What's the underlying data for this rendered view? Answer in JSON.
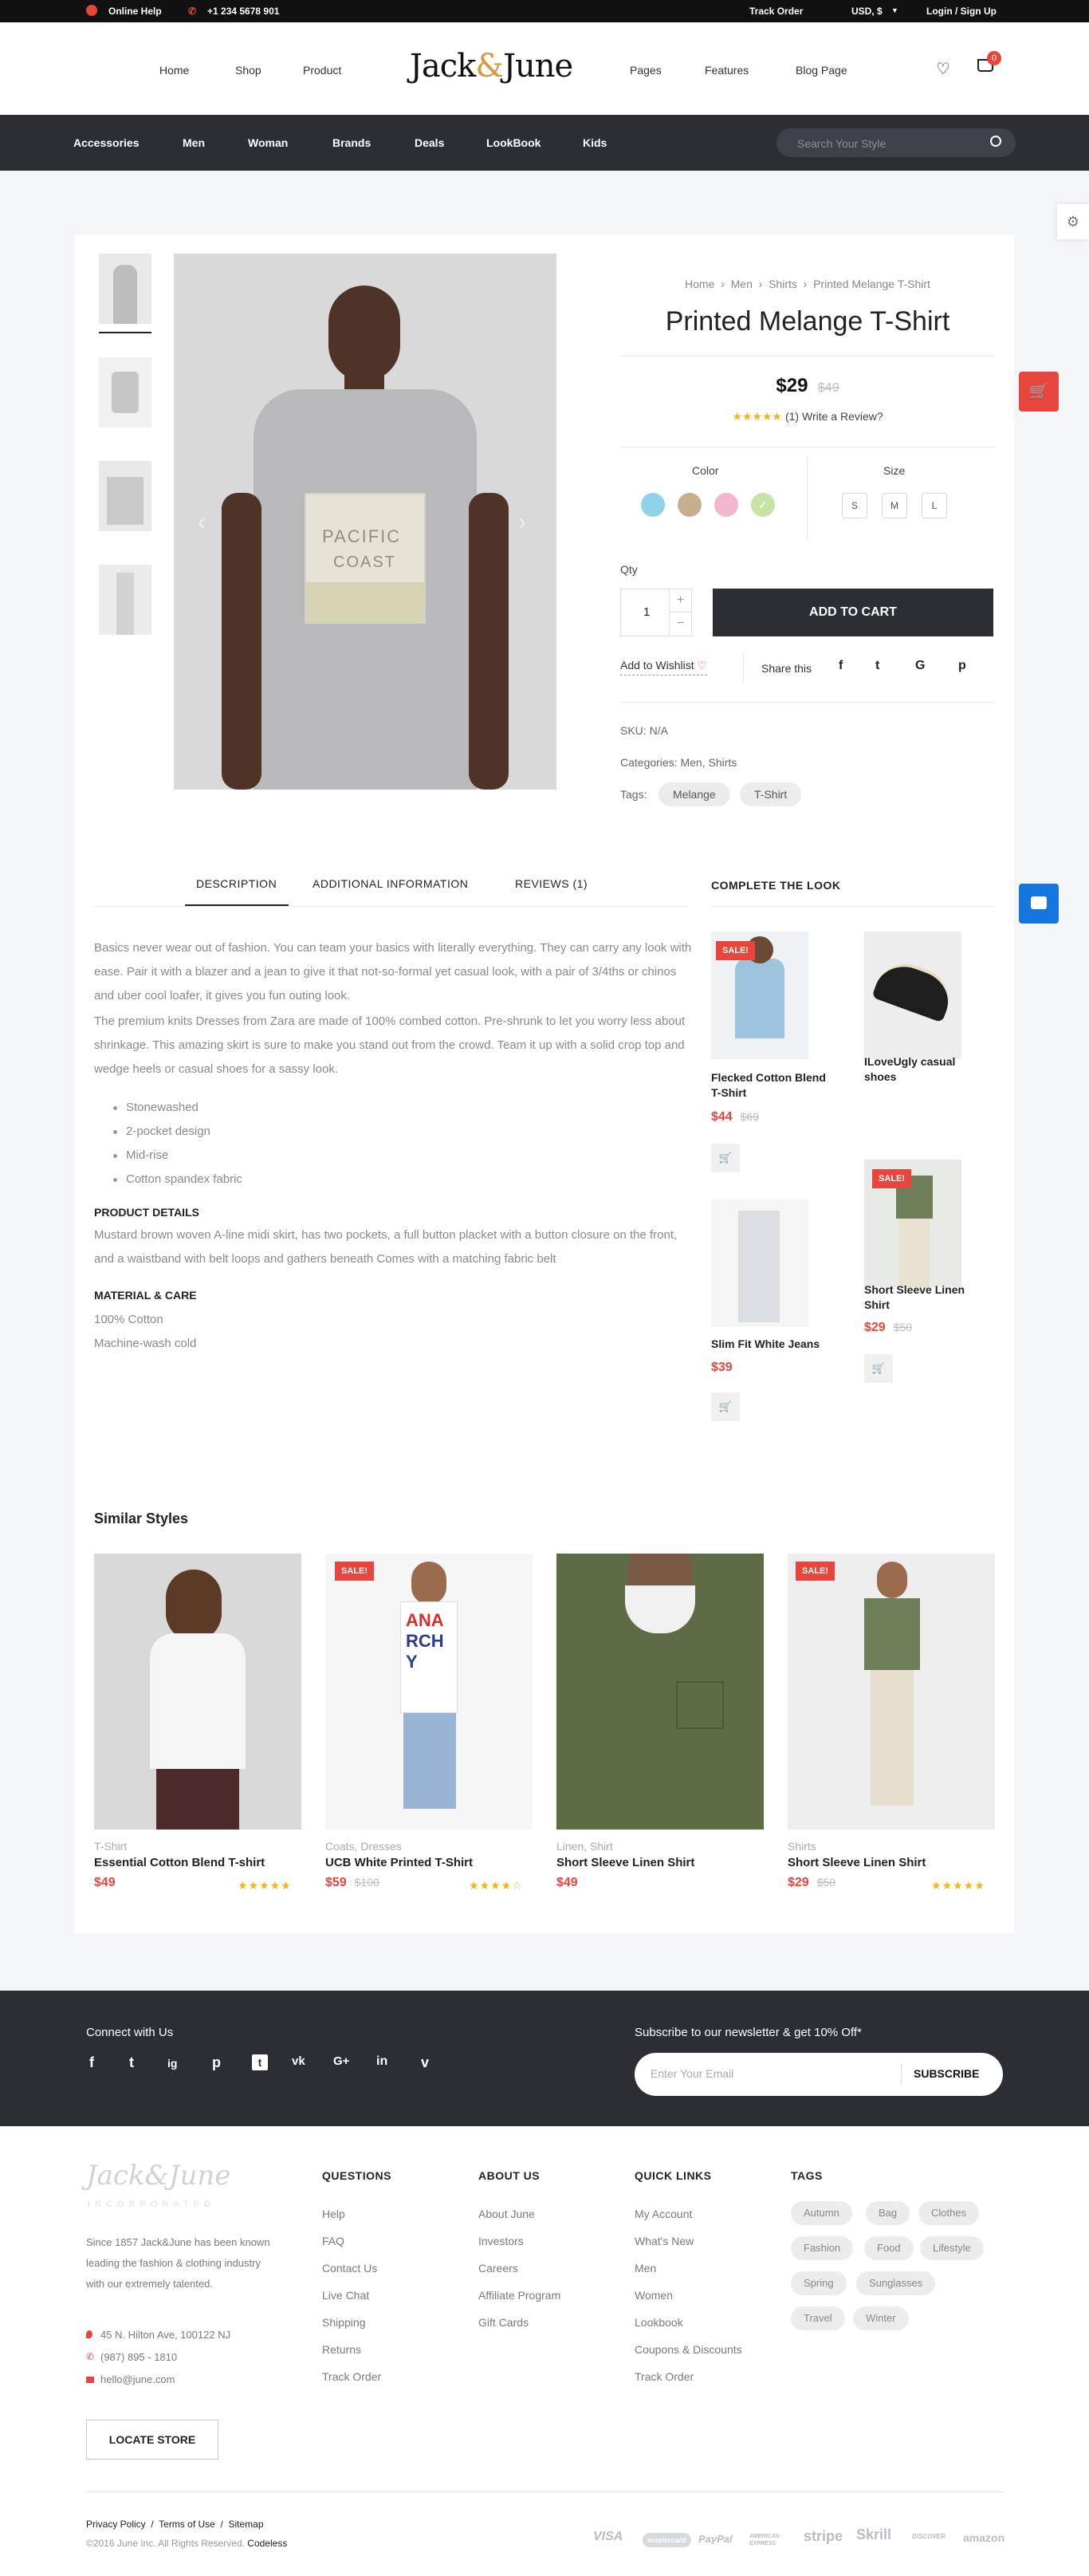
{
  "topbar": {
    "online_help": "Online Help",
    "phone": "+1 234 5678 901",
    "track_order": "Track Order",
    "currency": "USD, $",
    "login": "Login / Sign Up"
  },
  "header": {
    "nav_left": [
      "Home",
      "Shop",
      "Product"
    ],
    "logo_a": "Jack",
    "logo_amp": "&",
    "logo_b": "June",
    "nav_right": [
      "Pages",
      "Features",
      "Blog Page"
    ],
    "cart_count": "0"
  },
  "categories": [
    "Accessories",
    "Men",
    "Woman",
    "Brands",
    "Deals",
    "LookBook",
    "Kids"
  ],
  "search": {
    "placeholder": "Search Your Style"
  },
  "product": {
    "breadcrumb": [
      "Home",
      "Men",
      "Shirts",
      "Printed Melange T-Shirt"
    ],
    "title": "Printed Melange T-Shirt",
    "price": "$29",
    "old_price": "$49",
    "stars": "★★★★★",
    "review_text": "(1) Write a Review?",
    "color_label": "Color",
    "size_label": "Size",
    "sizes": [
      "S",
      "M",
      "L"
    ],
    "colors": [
      "#8fd3ea",
      "#c7ae8f",
      "#f2b6cf",
      "#c9e2a6"
    ],
    "qty_label": "Qty",
    "qty_value": "1",
    "add_to_cart": "ADD TO CART",
    "wishlist": "Add to Wishlist",
    "share": "Share this",
    "sku": "SKU: N/A",
    "categories": "Categories: Men, Shirts",
    "tags_label": "Tags:",
    "tags": [
      "Melange",
      "T-Shirt"
    ],
    "image_print_a": "PACIFIC",
    "image_print_b": "COAST"
  },
  "tabs": {
    "items": [
      "DESCRIPTION",
      "ADDITIONAL INFORMATION",
      "REVIEWS (1)"
    ],
    "p1": "Basics never wear out of fashion. You can team your basics with literally everything. They can carry any look with ease. Pair it with a blazer and a jean to give it that not-so-formal yet casual look, with a pair of 3/4ths or chinos and uber cool loafer, it gives you fun outing look.",
    "p2": "The premium knits Dresses from Zara are made of 100% combed cotton. Pre-shrunk to let you worry less about shrinkage. This amazing skirt is sure to make you stand out from the crowd. Team it up with a solid crop top and wedge heels or casual shoes for a sassy look.",
    "bullets": [
      "Stonewashed",
      "2-pocket design",
      "Mid-rise",
      "Cotton spandex fabric"
    ],
    "details_head": "PRODUCT DETAILS",
    "details": "Mustard brown woven A-line midi skirt, has two pockets, a full button placket with a button closure on the front, and a waistband with belt loops and gathers beneath Comes with a matching fabric belt",
    "care_head": "MATERIAL & CARE",
    "care": [
      "100% Cotton",
      "Machine-wash cold"
    ]
  },
  "complete_look": {
    "title": "COMPLETE THE LOOK",
    "sale": "SALE!",
    "items": [
      {
        "name": "Flecked Cotton Blend T-Shirt",
        "price": "$44",
        "old": "$69"
      },
      {
        "name": "ILoveUgly casual shoes",
        "price": "",
        "old": ""
      },
      {
        "name": "Slim Fit White Jeans",
        "price": "$39",
        "old": ""
      },
      {
        "name": "Short Sleeve Linen Shirt",
        "price": "$29",
        "old": "$50"
      }
    ]
  },
  "similar": {
    "title": "Similar Styles",
    "sale": "SALE!",
    "items": [
      {
        "cat": "T-Shirt",
        "name": "Essential Cotton Blend T-shirt",
        "price": "$49",
        "old": "",
        "stars": "★★★★★"
      },
      {
        "cat": "Coats, Dresses",
        "name": "UCB White Printed T-Shirt",
        "price": "$59",
        "old": "$100",
        "stars": "★★★★☆"
      },
      {
        "cat": "Linen, Shirt",
        "name": "Short Sleeve Linen Shirt",
        "price": "$49",
        "old": "",
        "stars": ""
      },
      {
        "cat": "Shirts",
        "name": "Short Sleeve Linen Shirt",
        "price": "$29",
        "old": "$50",
        "stars": "★★★★★"
      }
    ],
    "print_a": "ANA",
    "print_b": "RCH",
    "print_c": "Y"
  },
  "newsletter": {
    "connect": "Connect with Us",
    "social": [
      "f",
      "t",
      "ig",
      "p",
      "t",
      "vk",
      "G+",
      "in",
      "v"
    ],
    "title": "Subscribe to our newsletter & get 10% Off*",
    "placeholder": "Enter Your Email",
    "button": "SUBSCRIBE"
  },
  "footer": {
    "logo": "Jack&June",
    "logo_sub": "INCORPORATED",
    "about": [
      "Since 1857 Jack&June has been known",
      "leading the fashion & clothing industry",
      "with our extremely talented."
    ],
    "address": "45 N. Hilton Ave, 100122 NJ",
    "phone": "(987) 895 - 1810",
    "email": "hello@june.com",
    "locate": "LOCATE STORE",
    "questions_head": "QUESTIONS",
    "questions": [
      "Help",
      "FAQ",
      "Contact Us",
      "Live Chat",
      "Shipping",
      "Returns",
      "Track Order"
    ],
    "about_head": "ABOUT US",
    "about_links": [
      "About June",
      "Investors",
      "Careers",
      "Affiliate Program",
      "Gift Cards"
    ],
    "quick_head": "QUICK LINKS",
    "quick": [
      "My Account",
      "What's New",
      "Men",
      "Women",
      "Lookbook",
      "Coupons & Discounts",
      "Track Order"
    ],
    "tags_head": "TAGS",
    "tags": [
      "Autumn",
      "Bag",
      "Clothes",
      "Fashion",
      "Food",
      "Lifestyle",
      "Spring",
      "Sunglasses",
      "Travel",
      "Winter"
    ],
    "legal": [
      "Privacy Policy",
      "Terms of Use",
      "Sitemap"
    ],
    "copyright": "©2016 June Inc. All Rights Reserved.",
    "brand": "Codeless",
    "payments": [
      "VISA",
      "mastercard",
      "PayPal",
      "AMERICAN EXPRESS",
      "stripe",
      "Skrill",
      "DISCOVER",
      "amazon"
    ]
  }
}
